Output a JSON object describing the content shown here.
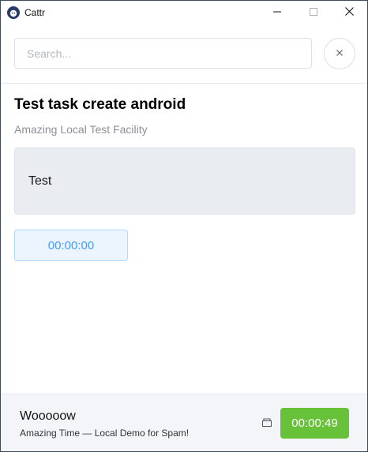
{
  "window": {
    "title": "Cattr",
    "app_icon": "cattr-logo-icon",
    "controls": {
      "minimize": "minimize-icon",
      "maximize": "maximize-icon",
      "close": "close-icon"
    }
  },
  "search": {
    "placeholder": "Search...",
    "value": "",
    "clear_icon": "close-icon"
  },
  "task": {
    "title": "Test task create android",
    "project": "Amazing Local Test Facility",
    "description": "Test",
    "timer": "00:00:00"
  },
  "footer": {
    "task_name": "Wooooow",
    "project_line": "Amazing Time — Local Demo for Spam!",
    "icon": "archive-icon",
    "timer": "00:00:49"
  },
  "colors": {
    "accent_blue": "#409eff",
    "timer_green": "#67c23a",
    "description_bg": "#e9ecf1",
    "footer_bg": "#f4f5f8"
  }
}
